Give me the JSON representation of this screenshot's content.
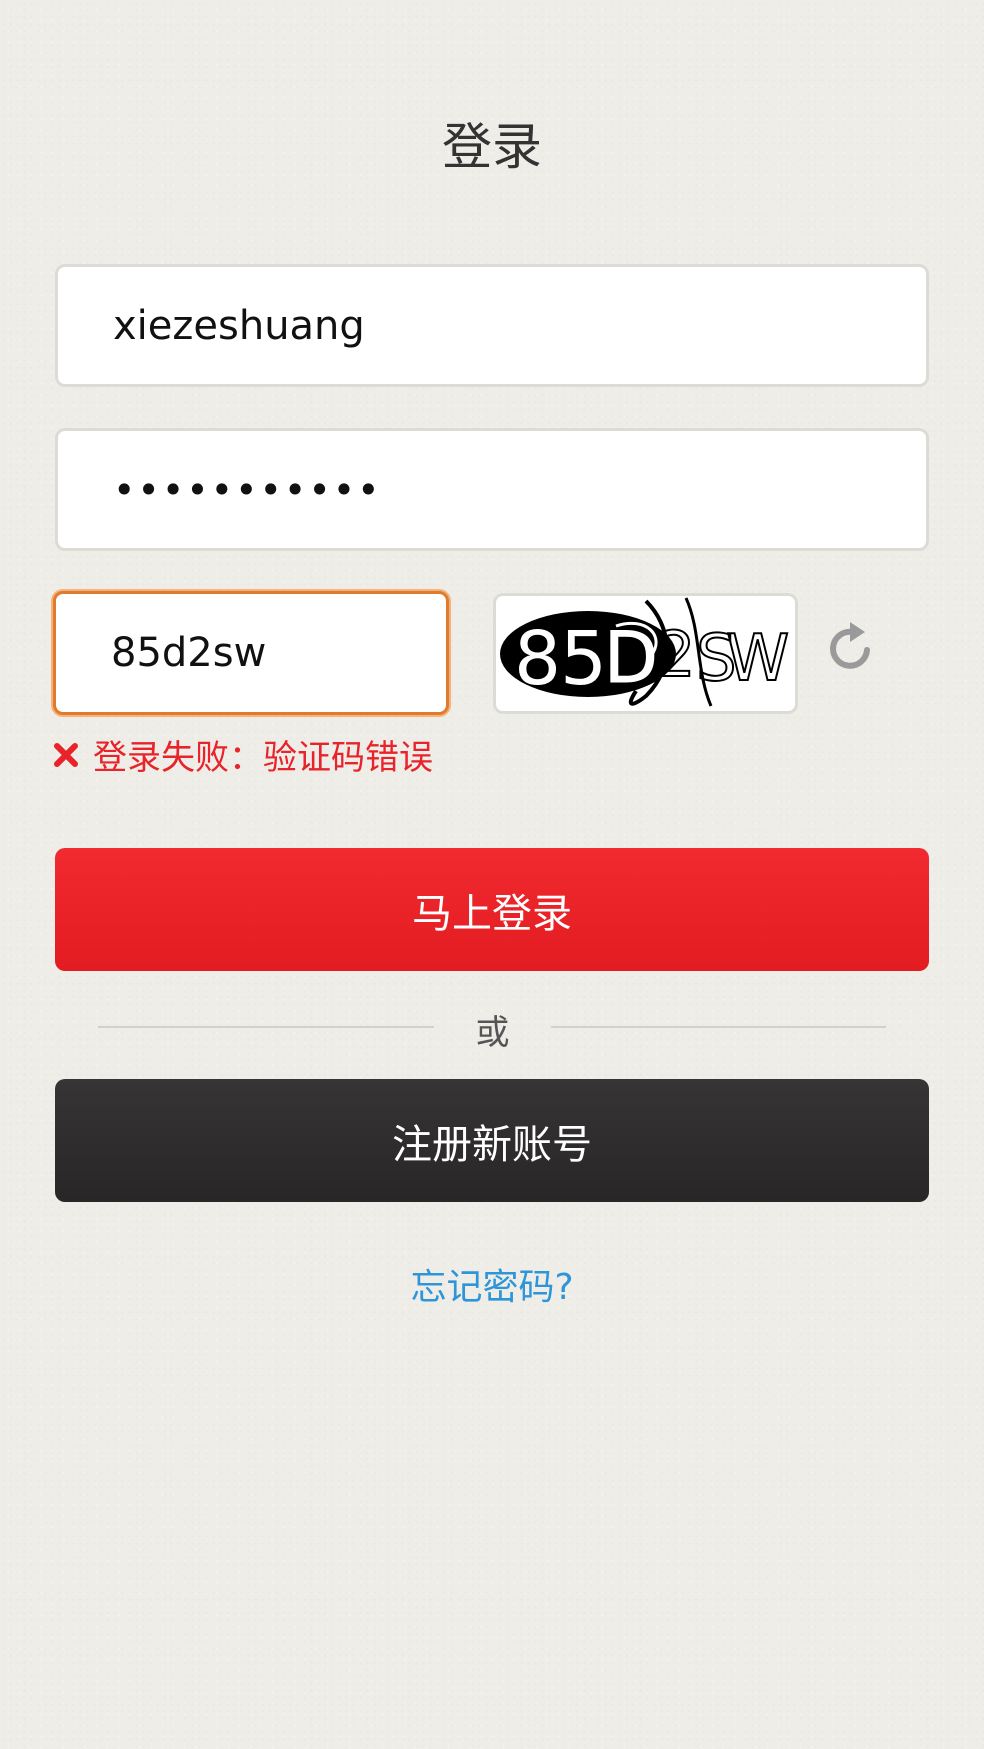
{
  "page": {
    "title": "登录"
  },
  "form": {
    "username_value": "xiezeshuang",
    "password_value": "•••••••••••",
    "captcha_value": "85d2sw"
  },
  "captcha_image": {
    "text": "85D2SW",
    "icon": "captcha-image"
  },
  "refresh": {
    "icon": "refresh-icon"
  },
  "error": {
    "icon": "close-icon",
    "message": "登录失败：验证码错误",
    "color": "#e8232a"
  },
  "buttons": {
    "login_label": "马上登录",
    "register_label": "注册新账号",
    "login_color": "#e31c22",
    "register_color": "#2b2929"
  },
  "divider": {
    "text": "或"
  },
  "links": {
    "forgot_password": "忘记密码?",
    "link_color": "#2e96d8"
  }
}
